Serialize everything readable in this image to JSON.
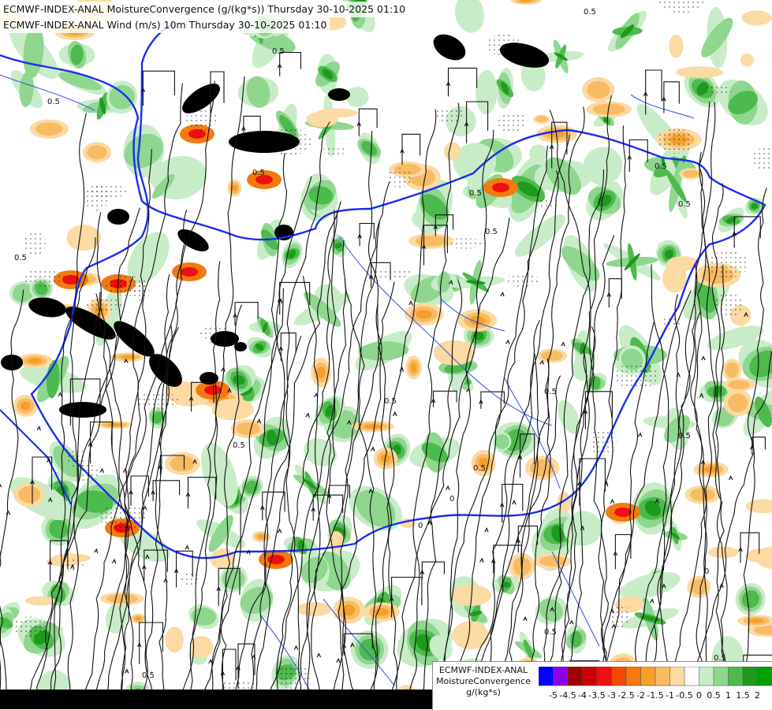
{
  "header": {
    "line1": "ECMWF-INDEX-ANAL MoistureConvergence (g/(kg*s)) Thursday 30-10-2025 01:10",
    "line2": "ECMWF-INDEX-ANAL Wind (m/s) 10m Thursday 30-10-2025 01:10"
  },
  "legend": {
    "title_line1": "ECMWF-INDEX-ANAL",
    "title_line2": "MoistureConvergence",
    "title_line3": "g/(kg*s)",
    "bins": [
      {
        "label": "-5",
        "color": "#0000ff"
      },
      {
        "label": "-4.5",
        "color": "#8a00e6"
      },
      {
        "label": "-4",
        "color": "#a00000"
      },
      {
        "label": "-3.5",
        "color": "#cc0000"
      },
      {
        "label": "-3",
        "color": "#ee1010"
      },
      {
        "label": "-2.5",
        "color": "#f04a00"
      },
      {
        "label": "-2",
        "color": "#f47a10"
      },
      {
        "label": "-1.5",
        "color": "#f59e2a"
      },
      {
        "label": "-1",
        "color": "#f8bb63"
      },
      {
        "label": "-0.5",
        "color": "#fbdaa3"
      },
      {
        "label": "0",
        "color": "#ffffff"
      },
      {
        "label": "0.5",
        "color": "#c8ecc8"
      },
      {
        "label": "1",
        "color": "#8fd68f"
      },
      {
        "label": "1.5",
        "color": "#4cba4c"
      },
      {
        "label": "2",
        "color": "#1e9a1e"
      },
      {
        "label": "",
        "color": "#00a000"
      }
    ],
    "tick_labels": [
      "-5",
      "-4.5",
      "-4",
      "-3.5",
      "-3",
      "-2.5",
      "-2",
      "-1.5",
      "-1",
      "-0.5",
      "0",
      "0.5",
      "1",
      "1.5",
      "2"
    ]
  },
  "map": {
    "contour_labels": [
      "0.5",
      "0.5",
      "0.5",
      "0.5",
      "0.5",
      "0.5",
      "0.5",
      "0.5",
      "0.5",
      "0.5",
      "0.5",
      "0.5",
      "0.5",
      "0.5",
      "0",
      "0",
      "0",
      "0.5",
      "0.5",
      "0.5"
    ],
    "colors": {
      "border": "#1a2ef0",
      "river": "#3f5cf5",
      "streamline": "#111111"
    }
  }
}
